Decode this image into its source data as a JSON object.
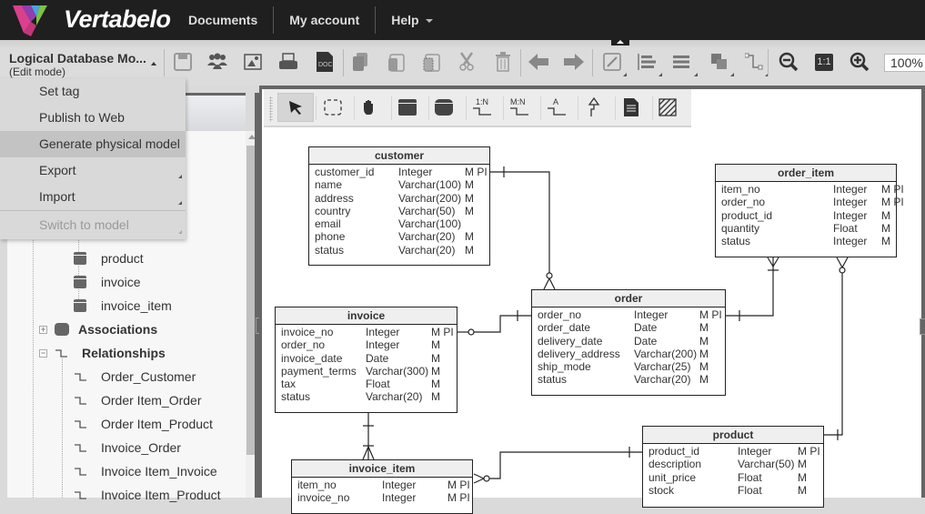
{
  "app": {
    "name": "Vertabelo"
  },
  "topnav": {
    "items": [
      {
        "label": "Documents"
      },
      {
        "label": "My account"
      },
      {
        "label": "Help"
      }
    ]
  },
  "model": {
    "title": "Logical Database Mo...",
    "mode": "(Edit mode)"
  },
  "toolbar": {
    "buttons": [
      "save-icon",
      "share-users-icon",
      "export-image-icon",
      "print-icon",
      "doc-report-icon",
      "copy-icon",
      "paste-icon",
      "paste-special-icon",
      "cut-icon",
      "delete-icon",
      "undo-icon",
      "redo-icon",
      "line-style-icon",
      "align-icon",
      "distribute-icon",
      "bring-front-icon",
      "line-route-icon",
      "zoom-out-icon",
      "zoom-reset-icon",
      "zoom-in-icon"
    ],
    "zoom_reset_label": "1:1",
    "zoom_value": "100%"
  },
  "menu": {
    "items": [
      {
        "label": "Set tag",
        "state": "normal"
      },
      {
        "label": "Publish to Web",
        "state": "normal"
      },
      {
        "label": "Generate physical model",
        "state": "highlighted"
      },
      {
        "label": "Export",
        "state": "submenu"
      },
      {
        "label": "Import",
        "state": "submenu"
      },
      {
        "label": "Switch to model",
        "state": "disabled-submenu"
      }
    ]
  },
  "tree": {
    "entities": [
      "product",
      "invoice",
      "invoice_item"
    ],
    "associations": "Associations",
    "relationships": "Relationships",
    "relationship_items": [
      "Order_Customer",
      "Order Item_Order",
      "Order Item_Product",
      "Invoice_Order",
      "Invoice Item_Invoice",
      "Invoice Item_Product"
    ]
  },
  "palette": {
    "tools": [
      "select-tool",
      "marquee-select-tool",
      "pan-hand-tool",
      "add-entity-tool",
      "add-association-tool",
      "relationship-1n-tool",
      "relationship-mn-tool",
      "attribute-relationship-tool",
      "inheritance-tool",
      "add-note-tool",
      "add-area-tool"
    ],
    "labels": {
      "one_n": "1:N",
      "m_n": "M:N",
      "attr": "A"
    }
  },
  "entities": {
    "customer": {
      "name": "customer",
      "rows": [
        [
          "customer_id",
          "Integer",
          "M PI"
        ],
        [
          "name",
          "Varchar(100)",
          "M"
        ],
        [
          "address",
          "Varchar(200)",
          "M"
        ],
        [
          "country",
          "Varchar(50)",
          "M"
        ],
        [
          "email",
          "Varchar(100)",
          ""
        ],
        [
          "phone",
          "Varchar(20)",
          "M"
        ],
        [
          "status",
          "Varchar(20)",
          "M"
        ]
      ]
    },
    "order_item": {
      "name": "order_item",
      "rows": [
        [
          "item_no",
          "Integer",
          "M PI"
        ],
        [
          "order_no",
          "Integer",
          "M PI"
        ],
        [
          "product_id",
          "Integer",
          "M"
        ],
        [
          "quantity",
          "Float",
          "M"
        ],
        [
          "status",
          "Integer",
          "M"
        ]
      ]
    },
    "order": {
      "name": "order",
      "rows": [
        [
          "order_no",
          "Integer",
          "M PI"
        ],
        [
          "order_date",
          "Date",
          "M"
        ],
        [
          "delivery_date",
          "Date",
          "M"
        ],
        [
          "delivery_address",
          "Varchar(200)",
          "M"
        ],
        [
          "ship_mode",
          "Varchar(25)",
          "M"
        ],
        [
          "status",
          "Varchar(20)",
          "M"
        ]
      ]
    },
    "invoice": {
      "name": "invoice",
      "rows": [
        [
          "invoice_no",
          "Integer",
          "M PI"
        ],
        [
          "order_no",
          "Integer",
          "M"
        ],
        [
          "invoice_date",
          "Date",
          "M"
        ],
        [
          "payment_terms",
          "Varchar(300)",
          "M"
        ],
        [
          "tax",
          "Float",
          "M"
        ],
        [
          "status",
          "Varchar(20)",
          "M"
        ]
      ]
    },
    "invoice_item": {
      "name": "invoice_item",
      "rows": [
        [
          "item_no",
          "Integer",
          "M PI"
        ],
        [
          "invoice_no",
          "Integer",
          "M PI"
        ]
      ]
    },
    "product": {
      "name": "product",
      "rows": [
        [
          "product_id",
          "Integer",
          "M PI"
        ],
        [
          "description",
          "Varchar(50)",
          "M"
        ],
        [
          "unit_price",
          "Float",
          "M"
        ],
        [
          "stock",
          "Float",
          "M"
        ]
      ]
    }
  }
}
